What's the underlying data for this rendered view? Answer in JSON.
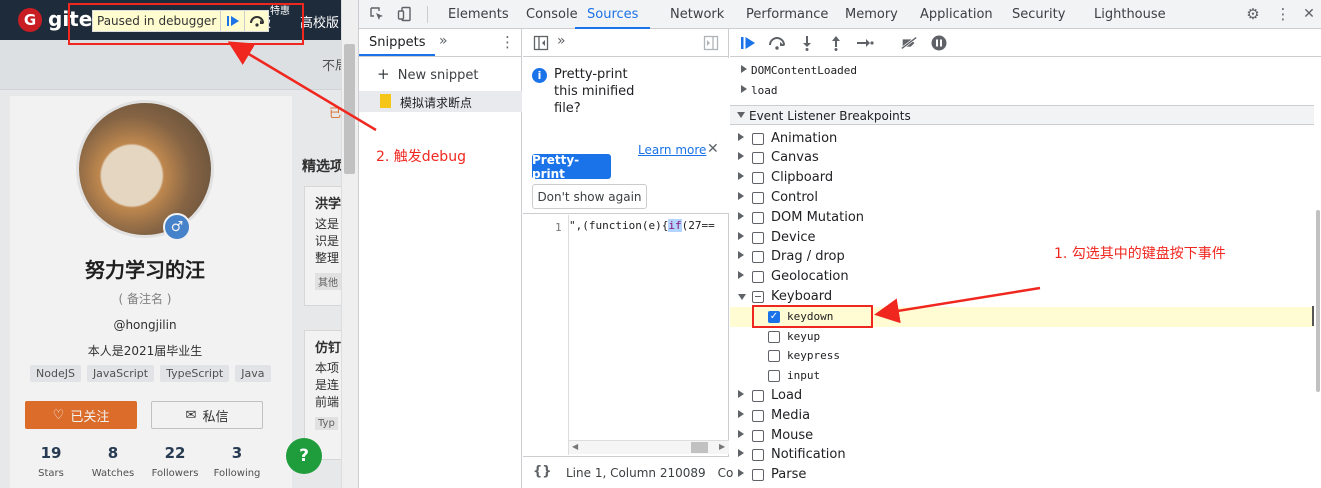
{
  "webpage": {
    "logo_text": "gite",
    "top_mid": "版",
    "top_right": "高校版",
    "top_badge": "特惠",
    "strip_text": "不局",
    "side_tab": "已",
    "profile": {
      "name": "努力学习的汪",
      "remark": "( 备注名 )",
      "handle": "@hongjilin",
      "bio": "本人是2021届毕业生",
      "tags": [
        "NodeJS",
        "JavaScript",
        "TypeScript",
        "Java"
      ],
      "follow_label": "已关注",
      "message_label": "私信",
      "stats": [
        {
          "num": "19",
          "label": "Stars"
        },
        {
          "num": "8",
          "label": "Watches"
        },
        {
          "num": "22",
          "label": "Followers"
        },
        {
          "num": "3",
          "label": "Following"
        }
      ]
    },
    "sidebar": {
      "title": "精选项",
      "box1": {
        "title": "洪学",
        "lines": [
          "这是",
          "识是",
          "整理"
        ],
        "badge": "其他"
      },
      "box2": {
        "title": "仿钉",
        "lines": [
          "本项",
          "是连",
          "前端"
        ],
        "badge": "Typ"
      }
    },
    "help_label": "?"
  },
  "paused_overlay": {
    "label": "Paused in debugger"
  },
  "annotations": {
    "step1": "1. 勾选其中的键盘按下事件",
    "step2": "2. 触发debug"
  },
  "devtools": {
    "tabs": [
      "Elements",
      "Console",
      "Sources",
      "Network",
      "Performance",
      "Memory",
      "Application",
      "Security",
      "Lighthouse"
    ],
    "active_tab": "Sources",
    "navigator": {
      "tab_label": "Snippets",
      "more": "»",
      "new_snippet": "New snippet",
      "items": [
        "模拟请求断点"
      ]
    },
    "editor": {
      "more": "»",
      "infobar_text": "Pretty-print this minified file?",
      "pretty_print_label": "Pretty-print",
      "dont_show_label": "Don't show again",
      "learn_more": "Learn more",
      "line_number": "1",
      "code_before": "\",(function(e){",
      "code_highlight": "if",
      "code_after": "(27==",
      "status_braces": "{}",
      "status_position": "Line 1, Column 210089",
      "status_trailing": "Co"
    },
    "debugger": {
      "dom_events": [
        "DOMContentLoaded",
        "load"
      ],
      "section_title": "Event Listener Breakpoints",
      "categories": [
        {
          "label": "Animation"
        },
        {
          "label": "Canvas"
        },
        {
          "label": "Clipboard"
        },
        {
          "label": "Control"
        },
        {
          "label": "DOM Mutation"
        },
        {
          "label": "Device"
        },
        {
          "label": "Drag / drop"
        },
        {
          "label": "Geolocation"
        },
        {
          "label": "Keyboard"
        }
      ],
      "keyboard_children": [
        {
          "label": "keydown",
          "checked": true
        },
        {
          "label": "keyup",
          "checked": false
        },
        {
          "label": "keypress",
          "checked": false
        },
        {
          "label": "input",
          "checked": false
        }
      ],
      "categories_after": [
        {
          "label": "Load"
        },
        {
          "label": "Media"
        },
        {
          "label": "Mouse"
        },
        {
          "label": "Notification"
        },
        {
          "label": "Parse"
        }
      ]
    }
  },
  "colors": {
    "accent": "#1a73e8",
    "annotation_red": "#f0271f",
    "highlight_row": "#fffbd3",
    "follow_orange": "#e8722c"
  }
}
